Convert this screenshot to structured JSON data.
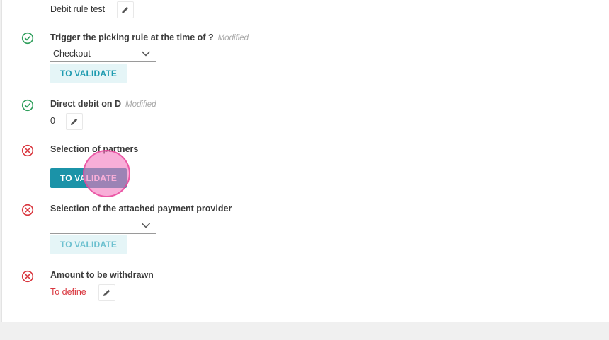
{
  "steps": [
    {
      "status": "done",
      "title": "",
      "value": "Debit rule test",
      "edit_icon": "pencil-icon"
    },
    {
      "status": "done",
      "title": "Trigger the picking rule at the time of ?",
      "modified": "Modified",
      "select_value": "Checkout",
      "button": "TO VALIDATE"
    },
    {
      "status": "done",
      "title": "Direct debit on D",
      "modified": "Modified",
      "value": "0",
      "edit_icon": "pencil-icon"
    },
    {
      "status": "error",
      "title": "Selection of partners",
      "button": "TO VALIDATE"
    },
    {
      "status": "error",
      "title": "Selection of the attached payment provider",
      "select_value": "",
      "button": "TO VALIDATE"
    },
    {
      "status": "error",
      "title": "Amount to be withdrawn",
      "value": "To define",
      "edit_icon": "pencil-icon"
    }
  ],
  "colors": {
    "success": "#2e9e5b",
    "error": "#d9363e",
    "accent": "#1b93a8",
    "accent_light": "#e5f5f7",
    "cursor_highlight": "#f378be"
  }
}
